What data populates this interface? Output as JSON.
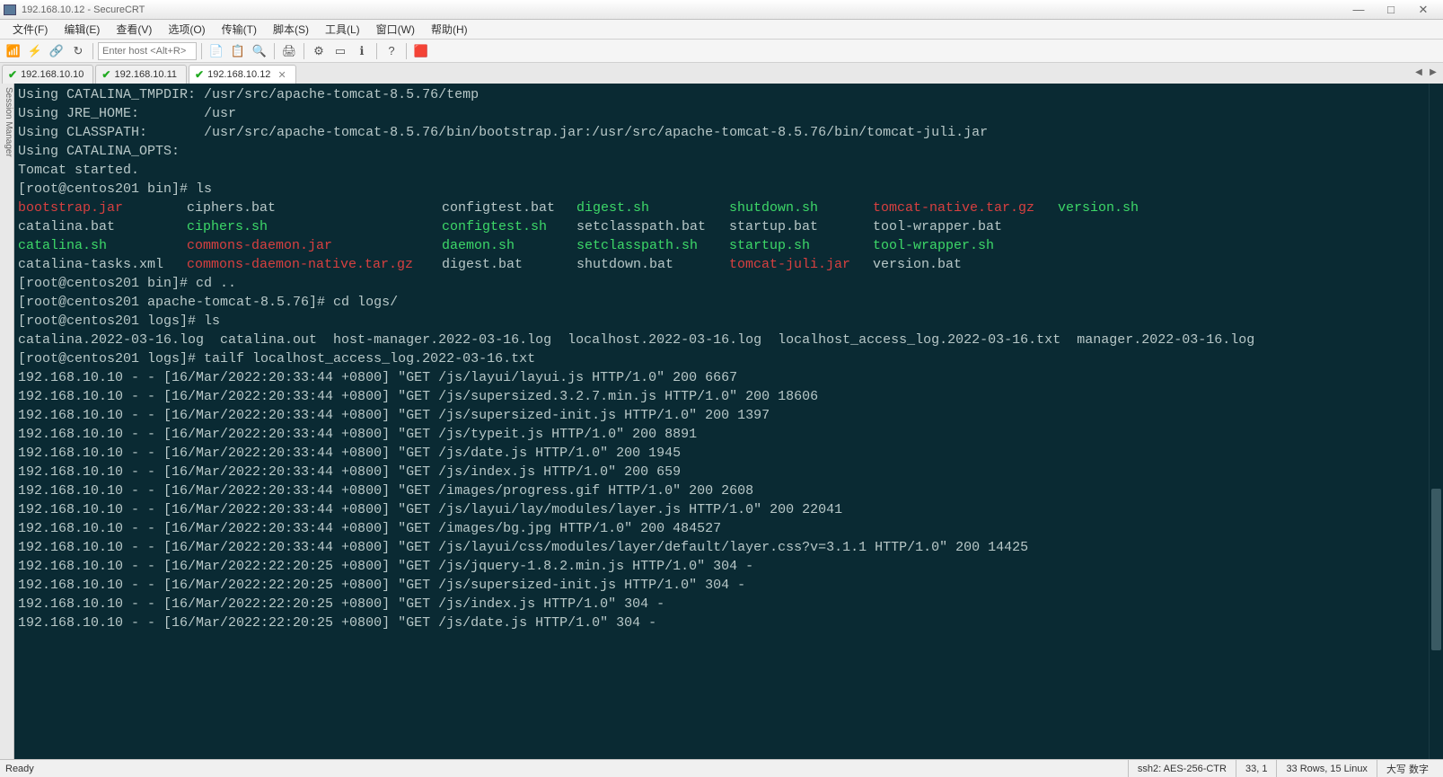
{
  "window": {
    "title": "192.168.10.12 - SecureCRT"
  },
  "winctrl": {
    "min": "—",
    "max": "□",
    "close": "✕"
  },
  "menu": [
    "文件(F)",
    "编辑(E)",
    "查看(V)",
    "选项(O)",
    "传输(T)",
    "脚本(S)",
    "工具(L)",
    "窗口(W)",
    "帮助(H)"
  ],
  "toolbar": {
    "host_placeholder": "Enter host <Alt+R>",
    "icons": [
      "reconnect",
      "bolt",
      "link",
      "refresh",
      "host",
      "copy",
      "paste",
      "find",
      "print",
      "settings",
      "monitor",
      "info",
      "help",
      "record"
    ]
  },
  "tabs": [
    {
      "label": "192.168.10.10",
      "active": false,
      "closable": false
    },
    {
      "label": "192.168.10.11",
      "active": false,
      "closable": false
    },
    {
      "label": "192.168.10.12",
      "active": true,
      "closable": true
    }
  ],
  "sidebar_label": "Session Manager",
  "terminal": {
    "intro": [
      "Using CATALINA_TMPDIR: /usr/src/apache-tomcat-8.5.76/temp",
      "Using JRE_HOME:        /usr",
      "Using CLASSPATH:       /usr/src/apache-tomcat-8.5.76/bin/bootstrap.jar:/usr/src/apache-tomcat-8.5.76/bin/tomcat-juli.jar",
      "Using CATALINA_OPTS:",
      "Tomcat started."
    ],
    "prompt1": "[root@centos201 bin]# ls",
    "ls_rows": [
      [
        {
          "t": "bootstrap.jar",
          "c": "red"
        },
        {
          "t": "ciphers.bat",
          "c": "def"
        },
        {
          "t": "configtest.bat",
          "c": "def"
        },
        {
          "t": "digest.sh",
          "c": "green"
        },
        {
          "t": "shutdown.sh",
          "c": "green"
        },
        {
          "t": "tomcat-native.tar.gz",
          "c": "red"
        },
        {
          "t": "version.sh",
          "c": "green"
        }
      ],
      [
        {
          "t": "catalina.bat",
          "c": "def"
        },
        {
          "t": "ciphers.sh",
          "c": "green"
        },
        {
          "t": "configtest.sh",
          "c": "green"
        },
        {
          "t": "setclasspath.bat",
          "c": "def"
        },
        {
          "t": "startup.bat",
          "c": "def"
        },
        {
          "t": "tool-wrapper.bat",
          "c": "def"
        },
        {
          "t": "",
          "c": "def"
        }
      ],
      [
        {
          "t": "catalina.sh",
          "c": "green"
        },
        {
          "t": "commons-daemon.jar",
          "c": "red"
        },
        {
          "t": "daemon.sh",
          "c": "green"
        },
        {
          "t": "setclasspath.sh",
          "c": "green"
        },
        {
          "t": "startup.sh",
          "c": "green"
        },
        {
          "t": "tool-wrapper.sh",
          "c": "green"
        },
        {
          "t": "",
          "c": "def"
        }
      ],
      [
        {
          "t": "catalina-tasks.xml",
          "c": "def"
        },
        {
          "t": "commons-daemon-native.tar.gz",
          "c": "red"
        },
        {
          "t": "digest.bat",
          "c": "def"
        },
        {
          "t": "shutdown.bat",
          "c": "def"
        },
        {
          "t": "tomcat-juli.jar",
          "c": "red"
        },
        {
          "t": "version.bat",
          "c": "def"
        },
        {
          "t": "",
          "c": "def"
        }
      ]
    ],
    "prompt2": "[root@centos201 bin]# cd ..",
    "prompt3": "[root@centos201 apache-tomcat-8.5.76]# cd logs/",
    "prompt4": "[root@centos201 logs]# ls",
    "ls2": "catalina.2022-03-16.log  catalina.out  host-manager.2022-03-16.log  localhost.2022-03-16.log  localhost_access_log.2022-03-16.txt  manager.2022-03-16.log",
    "prompt5": "[root@centos201 logs]# tailf localhost_access_log.2022-03-16.txt",
    "log": [
      "192.168.10.10 - - [16/Mar/2022:20:33:44 +0800] \"GET /js/layui/layui.js HTTP/1.0\" 200 6667",
      "192.168.10.10 - - [16/Mar/2022:20:33:44 +0800] \"GET /js/supersized.3.2.7.min.js HTTP/1.0\" 200 18606",
      "192.168.10.10 - - [16/Mar/2022:20:33:44 +0800] \"GET /js/supersized-init.js HTTP/1.0\" 200 1397",
      "192.168.10.10 - - [16/Mar/2022:20:33:44 +0800] \"GET /js/typeit.js HTTP/1.0\" 200 8891",
      "192.168.10.10 - - [16/Mar/2022:20:33:44 +0800] \"GET /js/date.js HTTP/1.0\" 200 1945",
      "192.168.10.10 - - [16/Mar/2022:20:33:44 +0800] \"GET /js/index.js HTTP/1.0\" 200 659",
      "192.168.10.10 - - [16/Mar/2022:20:33:44 +0800] \"GET /images/progress.gif HTTP/1.0\" 200 2608",
      "192.168.10.10 - - [16/Mar/2022:20:33:44 +0800] \"GET /js/layui/lay/modules/layer.js HTTP/1.0\" 200 22041",
      "192.168.10.10 - - [16/Mar/2022:20:33:44 +0800] \"GET /images/bg.jpg HTTP/1.0\" 200 484527",
      "192.168.10.10 - - [16/Mar/2022:20:33:44 +0800] \"GET /js/layui/css/modules/layer/default/layer.css?v=3.1.1 HTTP/1.0\" 200 14425",
      "192.168.10.10 - - [16/Mar/2022:22:20:25 +0800] \"GET /js/jquery-1.8.2.min.js HTTP/1.0\" 304 -",
      "192.168.10.10 - - [16/Mar/2022:22:20:25 +0800] \"GET /js/supersized-init.js HTTP/1.0\" 304 -",
      "192.168.10.10 - - [16/Mar/2022:22:20:25 +0800] \"GET /js/index.js HTTP/1.0\" 304 -",
      "192.168.10.10 - - [16/Mar/2022:22:20:25 +0800] \"GET /js/date.js HTTP/1.0\" 304 -"
    ]
  },
  "status": {
    "ready": "Ready",
    "proto": "ssh2: AES-256-CTR",
    "pos": "33,   1",
    "size": "33 Rows, 15 Linux",
    "caps": "大写 数字"
  }
}
